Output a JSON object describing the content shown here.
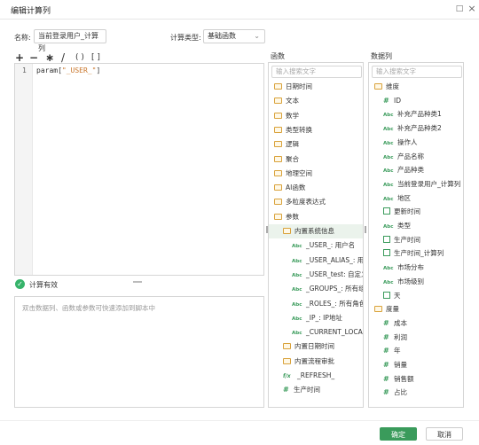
{
  "window": {
    "title": "编辑计算列",
    "minimize_glyph": "□",
    "close_glyph": "×"
  },
  "form": {
    "name_label": "名称:",
    "name_value": "当前登录用户_计算列",
    "type_label": "计算类型:",
    "type_value": "基础函数"
  },
  "toolbar": {
    "ops": [
      "+",
      "−",
      "∗",
      "/",
      "( )",
      "[ ]"
    ]
  },
  "editor": {
    "line_number": "1",
    "code_prefix": "param[",
    "code_string": "\"_USER_\"",
    "code_suffix": "]"
  },
  "status": {
    "text": "计算有效",
    "icon": "check-icon"
  },
  "hint": {
    "text": "双击数据列、函数或参数可快速添加到脚本中"
  },
  "functions_panel": {
    "title": "函数",
    "search_placeholder": "输入搜索文字",
    "items": [
      {
        "kind": "folder",
        "label": "日期时间",
        "indent": 0
      },
      {
        "kind": "folder",
        "label": "文本",
        "indent": 0
      },
      {
        "kind": "folder",
        "label": "数学",
        "indent": 0
      },
      {
        "kind": "folder",
        "label": "类型转换",
        "indent": 0
      },
      {
        "kind": "folder",
        "label": "逻辑",
        "indent": 0
      },
      {
        "kind": "folder",
        "label": "聚合",
        "indent": 0
      },
      {
        "kind": "folder",
        "label": "地理空间",
        "indent": 0
      },
      {
        "kind": "folder",
        "label": "AI函数",
        "indent": 0
      },
      {
        "kind": "folder",
        "label": "多粒度表达式",
        "indent": 0
      },
      {
        "kind": "folder",
        "label": "参数",
        "indent": 0
      },
      {
        "kind": "folder",
        "label": "内置系统信息",
        "indent": 1,
        "selected": true
      },
      {
        "kind": "abc",
        "label": "_USER_: 用户名",
        "indent": 2
      },
      {
        "kind": "abc",
        "label": "_USER_ALIAS_: 用户昵称",
        "indent": 2
      },
      {
        "kind": "abc",
        "label": "_USER_test: 自定义用户",
        "indent": 2
      },
      {
        "kind": "abc",
        "label": "_GROUPS_: 所有组",
        "indent": 2
      },
      {
        "kind": "abc",
        "label": "_ROLES_: 所有角色",
        "indent": 2
      },
      {
        "kind": "abc",
        "label": "_IP_: IP地址",
        "indent": 2
      },
      {
        "kind": "abc",
        "label": "_CURRENT_LOCALE_: 当",
        "indent": 2
      },
      {
        "kind": "folder",
        "label": "内置日期时间",
        "indent": 1
      },
      {
        "kind": "folder",
        "label": "内置流程审批",
        "indent": 1
      },
      {
        "kind": "fx",
        "label": "_REFRESH_",
        "indent": 1
      },
      {
        "kind": "hash",
        "label": "生产时间",
        "indent": 1
      }
    ]
  },
  "columns_panel": {
    "title": "数据列",
    "search_placeholder": "输入搜索文字",
    "items": [
      {
        "kind": "folder",
        "label": "维度",
        "indent": 0
      },
      {
        "kind": "hash",
        "label": "ID",
        "indent": 1
      },
      {
        "kind": "abc",
        "label": "补充产品种类1",
        "indent": 1
      },
      {
        "kind": "abc",
        "label": "补充产品种类2",
        "indent": 1
      },
      {
        "kind": "abc",
        "label": "操作人",
        "indent": 1
      },
      {
        "kind": "abc",
        "label": "产品名称",
        "indent": 1
      },
      {
        "kind": "abc",
        "label": "产品种类",
        "indent": 1
      },
      {
        "kind": "abc",
        "label": "当前登录用户_计算列",
        "indent": 1
      },
      {
        "kind": "abc",
        "label": "地区",
        "indent": 1
      },
      {
        "kind": "cal",
        "label": "更新时间",
        "indent": 1
      },
      {
        "kind": "abc",
        "label": "类型",
        "indent": 1
      },
      {
        "kind": "cal",
        "label": "生产时间",
        "indent": 1
      },
      {
        "kind": "cal",
        "label": "生产时间_计算列",
        "indent": 1
      },
      {
        "kind": "abc",
        "label": "市场分布",
        "indent": 1
      },
      {
        "kind": "abc",
        "label": "市场级别",
        "indent": 1
      },
      {
        "kind": "cal",
        "label": "天",
        "indent": 1
      },
      {
        "kind": "folder",
        "label": "度量",
        "indent": 0
      },
      {
        "kind": "hash",
        "label": "成本",
        "indent": 1
      },
      {
        "kind": "hash",
        "label": "利润",
        "indent": 1
      },
      {
        "kind": "hash",
        "label": "年",
        "indent": 1
      },
      {
        "kind": "hash",
        "label": "销量",
        "indent": 1
      },
      {
        "kind": "hash",
        "label": "销售额",
        "indent": 1
      },
      {
        "kind": "hash",
        "label": "占比",
        "indent": 1
      }
    ]
  },
  "footer": {
    "ok_label": "确定",
    "cancel_label": "取消"
  },
  "colors": {
    "accent": "#3a9b5b",
    "selected_bg": "#ebf3ec",
    "folder": "#d9a23b"
  }
}
